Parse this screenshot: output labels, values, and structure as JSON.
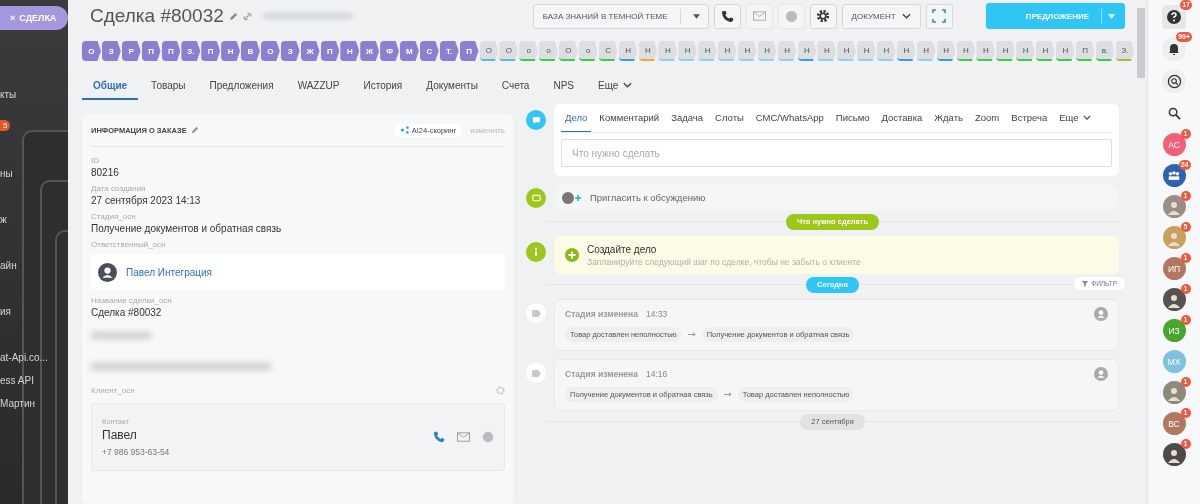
{
  "left_nav": {
    "close_tab": {
      "icon": "×",
      "label": "СДЕЛКА"
    },
    "items": [
      {
        "kind": "text",
        "label": "кты"
      },
      {
        "kind": "badge",
        "label": "5"
      },
      {
        "kind": "text",
        "label": "ны"
      },
      {
        "kind": "text",
        "label": "ж"
      },
      {
        "kind": "text",
        "label": "айн"
      },
      {
        "kind": "text",
        "label": "ия"
      },
      {
        "kind": "text",
        "label": "at-Api.co..."
      },
      {
        "kind": "text",
        "label": "ess API"
      },
      {
        "kind": "text",
        "label": "Мартин"
      }
    ]
  },
  "header": {
    "title": "Сделка #80032",
    "knowledge_button": "БАЗА ЗНАНИЙ В ТЕМНОЙ ТЕМЕ",
    "document_button": "ДОКУМЕНТ",
    "offer_button": "ПРЕДЛОЖЕНИЕ"
  },
  "stages": [
    {
      "label": "О",
      "done": true
    },
    {
      "label": "З",
      "done": true
    },
    {
      "label": "Р",
      "done": true
    },
    {
      "label": "П",
      "done": true
    },
    {
      "label": "П",
      "done": true
    },
    {
      "label": "З.",
      "done": true
    },
    {
      "label": "П",
      "done": true
    },
    {
      "label": "Н",
      "done": true
    },
    {
      "label": "В",
      "done": true
    },
    {
      "label": "О",
      "done": true
    },
    {
      "label": "З",
      "done": true
    },
    {
      "label": "Ж",
      "done": true
    },
    {
      "label": "П",
      "done": true
    },
    {
      "label": "Н",
      "done": true
    },
    {
      "label": "Ж",
      "done": true
    },
    {
      "label": "Ф",
      "done": true
    },
    {
      "label": "М",
      "done": true
    },
    {
      "label": "С",
      "done": true
    },
    {
      "label": "Т.",
      "done": true
    },
    {
      "label": "П",
      "done": true
    },
    {
      "label": "О",
      "done": false,
      "color": "#5ab8e6"
    },
    {
      "label": "О",
      "done": false,
      "color": "#5ab8e6"
    },
    {
      "label": "о",
      "done": false,
      "color": "#3dc94a"
    },
    {
      "label": "о",
      "done": false,
      "color": "#3dc94a"
    },
    {
      "label": "О",
      "done": false,
      "color": "#3dc94a"
    },
    {
      "label": "о",
      "done": false,
      "color": "#3dc94a"
    },
    {
      "label": "С",
      "done": false,
      "color": "#3dc94a"
    },
    {
      "label": "Н",
      "done": false,
      "color": "#3a9be0"
    },
    {
      "label": "Н",
      "done": false,
      "color": "#f0a634"
    },
    {
      "label": "Н",
      "done": false,
      "color": "#8fd0ef"
    },
    {
      "label": "Н",
      "done": false,
      "color": "#8fd0ef"
    },
    {
      "label": "Н",
      "done": false,
      "color": "#8fd0ef"
    },
    {
      "label": "Н",
      "done": false,
      "color": "#8fd0ef"
    },
    {
      "label": "Н",
      "done": false,
      "color": "#8fd0ef"
    },
    {
      "label": "Н",
      "done": false,
      "color": "#8fd0ef"
    },
    {
      "label": "Н",
      "done": false,
      "color": "#8fd0ef"
    },
    {
      "label": "Н",
      "done": false,
      "color": "#3a9be0"
    },
    {
      "label": "Н",
      "done": false,
      "color": "#8fd0ef"
    },
    {
      "label": "Н",
      "done": false,
      "color": "#8fd0ef"
    },
    {
      "label": "Н",
      "done": false,
      "color": "#8fd0ef"
    },
    {
      "label": "Н",
      "done": false,
      "color": "#8fd0ef"
    },
    {
      "label": "Н",
      "done": false,
      "color": "#3a9be0"
    },
    {
      "label": "Н",
      "done": false,
      "color": "#8fd0ef"
    },
    {
      "label": "Н",
      "done": false,
      "color": "#3a9be0"
    },
    {
      "label": "Н",
      "done": false,
      "color": "#3dc94a"
    },
    {
      "label": "Н",
      "done": false,
      "color": "#3dc94a"
    },
    {
      "label": "Н",
      "done": false,
      "color": "#3dc94a"
    },
    {
      "label": "Н",
      "done": false,
      "color": "#3dc94a"
    },
    {
      "label": "Н",
      "done": false,
      "color": "#3dc94a"
    },
    {
      "label": "Н",
      "done": false,
      "color": "#3dc94a"
    },
    {
      "label": "П",
      "done": false,
      "color": "#3dc94a"
    },
    {
      "label": "в.",
      "done": false,
      "color": "#3dc94a"
    },
    {
      "label": "З.",
      "done": false,
      "color": "#b8b43a"
    }
  ],
  "tabs": [
    {
      "label": "Общие",
      "selected": true
    },
    {
      "label": "Товары",
      "selected": false
    },
    {
      "label": "Предложения",
      "selected": false
    },
    {
      "label": "WAZZUP",
      "selected": false
    },
    {
      "label": "История",
      "selected": false
    },
    {
      "label": "Документы",
      "selected": false
    },
    {
      "label": "Счета",
      "selected": false
    },
    {
      "label": "NPS",
      "selected": false
    },
    {
      "label": "Еще",
      "selected": false,
      "kind": "more"
    }
  ],
  "order_card": {
    "title": "ИНФОРМАЦИЯ О ЗАКАЗЕ",
    "scoring": "AI24-скоринг",
    "edit_link": "изменить",
    "fields": [
      {
        "kind": "text",
        "label": "ID",
        "value": "80216"
      },
      {
        "kind": "text",
        "label": "Дата создания",
        "value": "27 сентября 2023 14:13"
      },
      {
        "kind": "text",
        "label": "Стадия_осн",
        "value": "Получение документов и обратная связь"
      },
      {
        "kind": "user",
        "label": "Ответственный_осн",
        "value": "Павел Интеграция"
      },
      {
        "kind": "text",
        "label": "Название сделки_осн",
        "value": "Сделка #80032"
      },
      {
        "kind": "blurred"
      },
      {
        "kind": "blurred"
      }
    ],
    "client": {
      "label": "Клиент_осн",
      "contact_label": "Контакт",
      "name": "Павел",
      "phone": "+7 986 953-63-54"
    }
  },
  "composer": {
    "tabs": [
      {
        "label": "Дело",
        "selected": true
      },
      {
        "label": "Комментарий",
        "selected": false
      },
      {
        "label": "Задача",
        "selected": false
      },
      {
        "label": "Слоты",
        "selected": false
      },
      {
        "label": "СМС/WhatsApp",
        "selected": false
      },
      {
        "label": "Письмо",
        "selected": false
      },
      {
        "label": "Доставка",
        "selected": false
      },
      {
        "label": "Ждать",
        "selected": false
      },
      {
        "label": "Zoom",
        "selected": false
      },
      {
        "label": "Встреча",
        "selected": false
      },
      {
        "label": "Еще",
        "selected": false,
        "kind": "more"
      }
    ],
    "placeholder": "Что нужно сделать"
  },
  "invite": "Пригласить к обсуждению",
  "todo_pill": "Что нужно сделать",
  "create_task": {
    "title": "Создайте дело",
    "hint": "Запланируйте следующий шаг по сделке, чтобы не забыть о клиенте"
  },
  "today_pill": "Сегодня",
  "filter_button": "ФИЛЬТР",
  "history": [
    {
      "title": "Стадия изменена",
      "time": "14:33",
      "from": "Товар доставлен неполностью",
      "to": "Получение документов и обратная связь"
    },
    {
      "title": "Стадия изменена",
      "time": "14:16",
      "from": "Получение документов и обратная связь",
      "to": "Товар доставлен неполностью"
    }
  ],
  "date_pill": "27 сентября",
  "right_bar": {
    "help_badge": "17",
    "bell_badge": "99+",
    "contacts": [
      {
        "kind": "initials",
        "initials": "АС",
        "color": "#f0607a",
        "badge": "1"
      },
      {
        "kind": "group",
        "color": "#2d62b0",
        "badge": "24"
      },
      {
        "kind": "photo",
        "color": "#9a8f86",
        "badge": "1"
      },
      {
        "kind": "photo",
        "color": "#c9a060",
        "badge": "5"
      },
      {
        "kind": "initials",
        "initials": "ИП",
        "color": "#b07860",
        "badge": "1"
      },
      {
        "kind": "photo",
        "color": "#55524f",
        "badge": "1"
      },
      {
        "kind": "initials",
        "initials": "ИЗ",
        "color": "#4aa52e",
        "badge": "1"
      },
      {
        "kind": "initials",
        "initials": "МХ",
        "color": "#7fc2e0"
      },
      {
        "kind": "photo",
        "color": "#8c8a7a",
        "badge": "1"
      },
      {
        "kind": "initials",
        "initials": "ВС",
        "color": "#b07860",
        "badge": "1"
      },
      {
        "kind": "photo",
        "color": "#4d4a48",
        "badge": "1"
      }
    ]
  }
}
